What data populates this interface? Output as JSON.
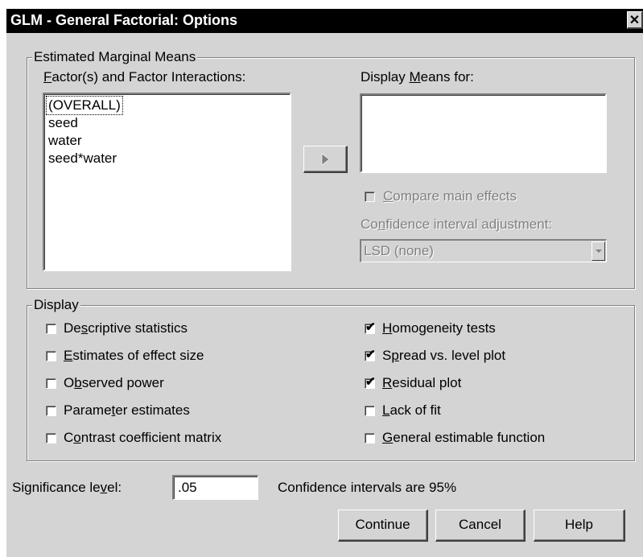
{
  "window": {
    "title": "GLM - General Factorial: Options",
    "close_glyph": "✕"
  },
  "emm": {
    "legend": "Estimated Marginal Means",
    "factors_label_pre": "",
    "factors_label_mnemonic": "F",
    "factors_label_post": "actor(s) and Factor Interactions:",
    "factors": [
      "(OVERALL)",
      "seed",
      "water",
      "seed*water"
    ],
    "move_button_icon": "right-arrow-icon",
    "display_means_pre": "Display ",
    "display_means_mnemonic": "M",
    "display_means_post": "eans for:",
    "compare_pre": "",
    "compare_mnemonic": "C",
    "compare_post": "ompare main effects",
    "ci_adj_pre": "Co",
    "ci_adj_mnemonic": "n",
    "ci_adj_post": "fidence interval adjustment:",
    "ci_adj_value": "LSD (none)"
  },
  "display": {
    "legend": "Display",
    "left": [
      {
        "pre": "De",
        "mn": "s",
        "post": "criptive statistics",
        "checked": false
      },
      {
        "pre": "",
        "mn": "E",
        "post": "stimates of effect size",
        "checked": false
      },
      {
        "pre": "O",
        "mn": "b",
        "post": "served power",
        "checked": false
      },
      {
        "pre": "Parame",
        "mn": "t",
        "post": "er estimates",
        "checked": false
      },
      {
        "pre": "C",
        "mn": "o",
        "post": "ntrast coefficient matrix",
        "checked": false
      }
    ],
    "right": [
      {
        "pre": "",
        "mn": "H",
        "post": "omogeneity tests",
        "checked": true
      },
      {
        "pre": "S",
        "mn": "p",
        "post": "read vs. level plot",
        "checked": true
      },
      {
        "pre": "",
        "mn": "R",
        "post": "esidual plot",
        "checked": true
      },
      {
        "pre": "",
        "mn": "L",
        "post": "ack of fit",
        "checked": false
      },
      {
        "pre": "",
        "mn": "G",
        "post": "eneral estimable function",
        "checked": false
      }
    ]
  },
  "significance": {
    "label_pre": "Significance le",
    "label_mnemonic": "v",
    "label_post": "el:",
    "value": ".05",
    "ci_text": "Confidence intervals are 95%"
  },
  "buttons": {
    "continue": "Continue",
    "cancel": "Cancel",
    "help": "Help"
  },
  "check_glyph": "✔"
}
